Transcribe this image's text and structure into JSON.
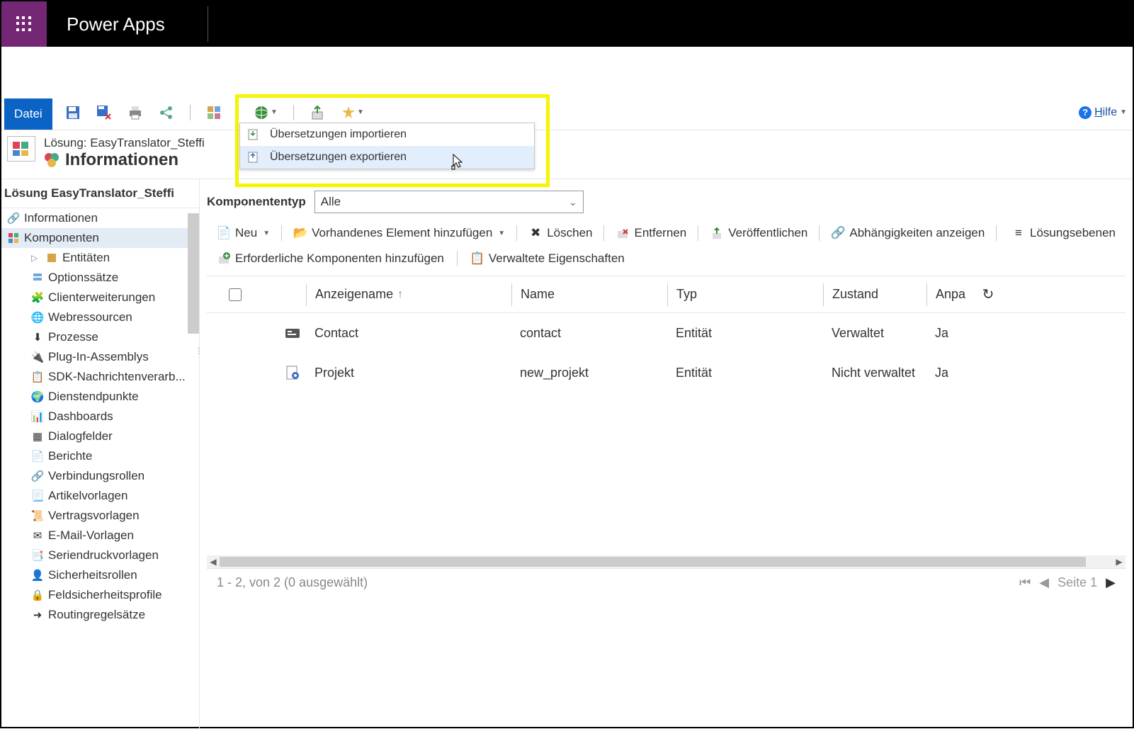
{
  "header": {
    "app_title": "Power Apps"
  },
  "cmdbar": {
    "file": "Datei",
    "help": "Hilfe"
  },
  "dropdown": {
    "import": "Übersetzungen importieren",
    "export": "Übersetzungen exportieren"
  },
  "solution": {
    "line1": "Lösung: EasyTranslator_Steffi",
    "line2": "Informationen"
  },
  "sidebar": {
    "title": "Lösung EasyTranslator_Steffi",
    "items": [
      "Informationen",
      "Komponenten",
      "Entitäten",
      "Optionssätze",
      "Clienterweiterungen",
      "Webressourcen",
      "Prozesse",
      "Plug-In-Assemblys",
      "SDK-Nachrichtenverarb...",
      "Dienstendpunkte",
      "Dashboards",
      "Dialogfelder",
      "Berichte",
      "Verbindungsrollen",
      "Artikelvorlagen",
      "Vertragsvorlagen",
      "E-Mail-Vorlagen",
      "Seriendruckvorlagen",
      "Sicherheitsrollen",
      "Feldsicherheitsprofile",
      "Routingregelsätze"
    ]
  },
  "filter": {
    "label": "Komponententyp",
    "value": "Alle"
  },
  "actions": {
    "neu": "Neu",
    "vorhanden": "Vorhandenes Element hinzufügen",
    "loeschen": "Löschen",
    "entfernen": "Entfernen",
    "veroeff": "Veröffentlichen",
    "abhaeng": "Abhängigkeiten anzeigen",
    "erforder": "Erforderliche Komponenten hinzufügen",
    "verwaltet": "Verwaltete Eigenschaften",
    "loesungsebenen": "Lösungsebenen"
  },
  "grid": {
    "cols": {
      "anzeige": "Anzeigename",
      "name": "Name",
      "typ": "Typ",
      "zustand": "Zustand",
      "anpa": "Anpa"
    },
    "rows": [
      {
        "anzeige": "Contact",
        "name": "contact",
        "typ": "Entität",
        "zustand": "Verwaltet",
        "anpa": "Ja"
      },
      {
        "anzeige": "Projekt",
        "name": "new_projekt",
        "typ": "Entität",
        "zustand": "Nicht verwaltet",
        "anpa": "Ja"
      }
    ]
  },
  "footer": {
    "count": "1 - 2, von 2 (0 ausgewählt)",
    "page": "Seite 1"
  }
}
